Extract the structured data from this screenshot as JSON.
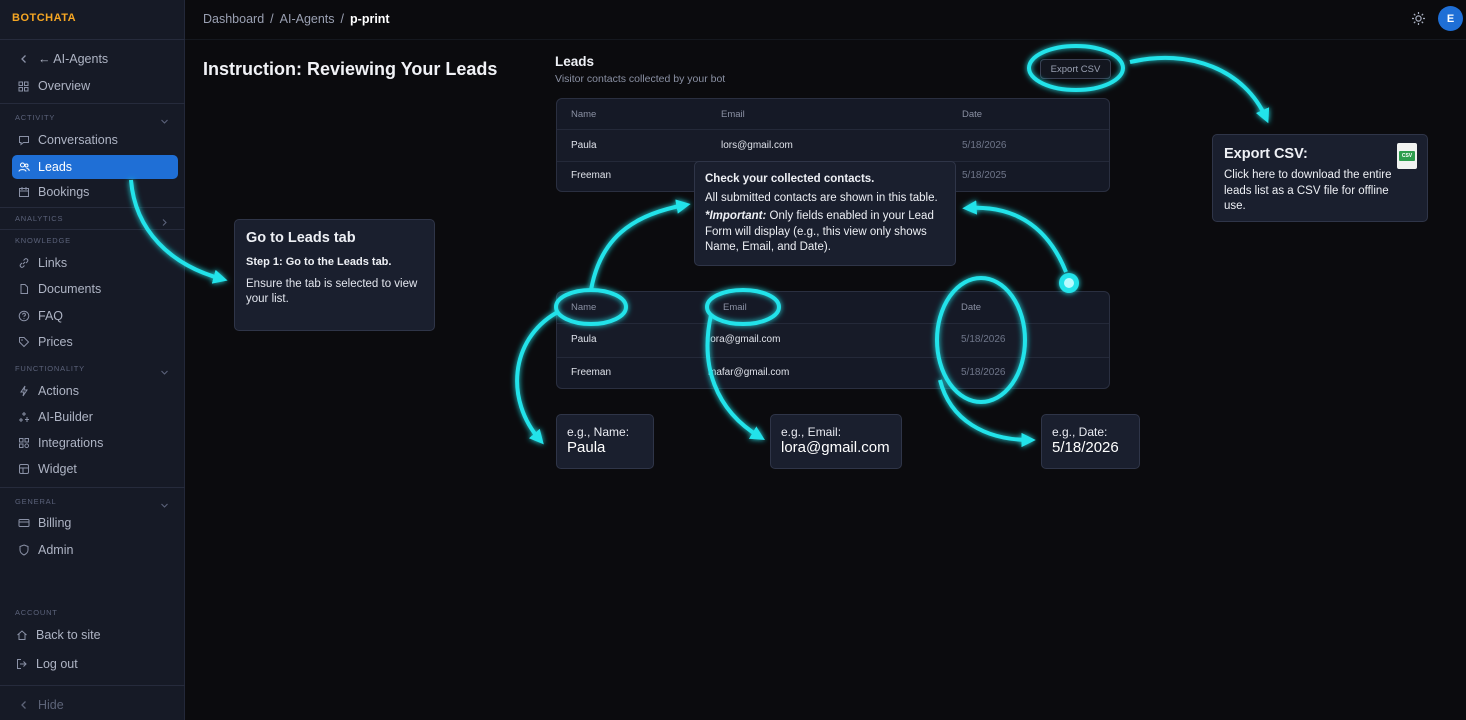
{
  "brand": "BOTCHATA",
  "breadcrumb": [
    "Dashboard",
    "/",
    "AI-Agents",
    "/",
    "p-print"
  ],
  "avatar_initial": "E",
  "page_title": "Instruction: Reviewing Your Leads",
  "sidebar": {
    "back_label": "← AI-Agents",
    "overview": "Overview",
    "sections": {
      "activity": "ACTIVITY",
      "analytics": "ANALYTICS",
      "knowledge": "KNOWLEDGE",
      "functionality": "FUNCTIONALITY",
      "general": "GENERAL",
      "account": "ACCOUNT"
    },
    "items": {
      "conversations": "Conversations",
      "leads": "Leads",
      "bookings": "Bookings",
      "links": "Links",
      "documents": "Documents",
      "faq": "FAQ",
      "prices": "Prices",
      "actions": "Actions",
      "ai_builder": "AI-Builder",
      "integrations": "Integrations",
      "widget": "Widget",
      "billing": "Billing",
      "admin": "Admin",
      "back_to_site": "Back to site",
      "log_out": "Log out",
      "hide": "Hide"
    }
  },
  "leads": {
    "title": "Leads",
    "subtitle": "Visitor contacts collected by your bot",
    "export_label": "Export CSV",
    "columns": [
      "Name",
      "Email",
      "Date"
    ],
    "table1_rows": [
      {
        "name": "Paula",
        "email": "lors@gmail.com",
        "date": "5/18/2026"
      },
      {
        "name": "Freeman",
        "email": "",
        "date": "5/18/2025"
      }
    ],
    "table2_rows": [
      {
        "name": "Paula",
        "email": "lora@gmail.com",
        "date": "5/18/2026"
      },
      {
        "name": "Freeman",
        "email": "mafar@gmail.com",
        "date": "5/18/2026"
      }
    ]
  },
  "callouts": {
    "step1": {
      "title": "Go to Leads tab",
      "subtitle": "Step 1: Go to the Leads tab.",
      "body": "Ensure the tab is selected to view your list."
    },
    "check": {
      "title": "Check your collected contacts.",
      "body": "All submitted contacts are shown in this table.",
      "important_label": "*Important:",
      "important_body": "Only fields enabled in your Lead Form will display (e.g., this view only shows Name, Email, and Date)."
    },
    "export": {
      "title": "Export CSV:",
      "body": "Click here to download the entire leads list as a CSV file for offline use.",
      "file_icon_text": "CSV"
    },
    "example_name": {
      "label": "e.g., Name:",
      "value": "Paula"
    },
    "example_email": {
      "label": "e.g., Email:",
      "value": "lora@gmail.com"
    },
    "example_date": {
      "label": "e.g., Date:",
      "value": "5/18/2026"
    }
  },
  "colors": {
    "accent": "#1f6fd6",
    "glow": "#22e3ea",
    "brand": "#f5a623"
  }
}
